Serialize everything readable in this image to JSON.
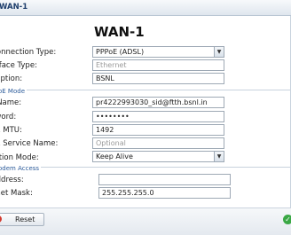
{
  "window": {
    "title": "WAN-1"
  },
  "form": {
    "heading": "WAN-1",
    "rows": [
      {
        "label": "Connection Type:",
        "value": "PPPoE (ADSL)"
      },
      {
        "label": "erface Type:",
        "placeholder": "Ethernet"
      },
      {
        "label": "cription:",
        "value": "BSNL"
      },
      {
        "label": "r Name:",
        "value": "pr4222993030_sid@ftth.bsnl.in"
      },
      {
        "label": "sword:",
        "value": "••••••••"
      },
      {
        "label": "oE MTU:",
        "value": "1492"
      },
      {
        "label": "oE Service Name:",
        "placeholder": "Optional"
      },
      {
        "label": "ration Mode:",
        "value": "Keep Alive"
      },
      {
        "label": "Address:",
        "value": ""
      },
      {
        "label": "bnet Mask:",
        "value": "255.255.255.0"
      }
    ],
    "sections": {
      "pppoe": "oE Mode",
      "modem": "odem Access"
    }
  },
  "footer": {
    "reset_label": "Reset"
  },
  "icons": {
    "dropdown": "chevron-down-icon",
    "reset": "reset-icon",
    "confirm": "checkmark-icon"
  }
}
